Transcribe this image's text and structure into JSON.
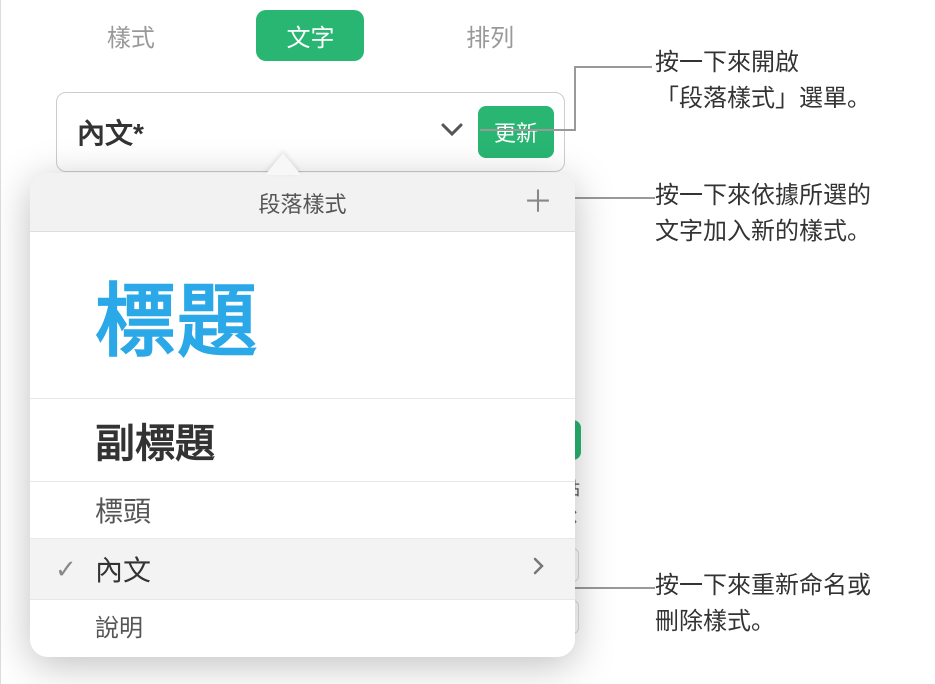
{
  "tabs": {
    "style": "樣式",
    "text": "文字",
    "arrange": "排列"
  },
  "selector": {
    "current_style": "內文*",
    "update_btn": "更新"
  },
  "popover": {
    "title": "段落樣式",
    "items": {
      "title": "標題",
      "subtitle": "副標題",
      "heading": "標頭",
      "body": "內文",
      "caption": "說明"
    }
  },
  "bg": {
    "unit": "點"
  },
  "annotations": {
    "a1_l1": "按一下來開啟",
    "a1_l2": "「段落樣式」選單。",
    "a2_l1": "按一下來依據所選的",
    "a2_l2": "文字加入新的樣式。",
    "a3_l1": "按一下來重新命名或",
    "a3_l2": "刪除樣式。"
  }
}
